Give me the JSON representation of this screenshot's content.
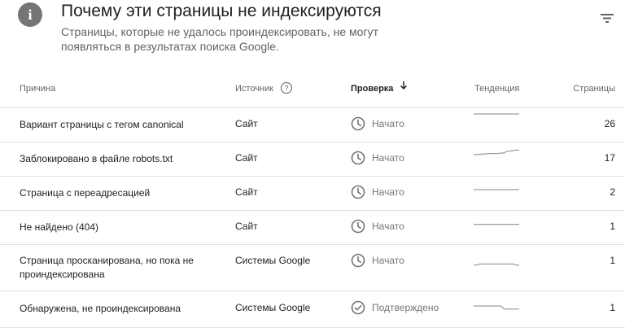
{
  "header": {
    "icon": "info-icon",
    "icon_glyph": "i",
    "title": "Почему эти страницы не индексируются",
    "subtitle": "Страницы, которые не удалось проиндексировать, не могут появляться в результатах поиска Google."
  },
  "table": {
    "columns": {
      "reason": "Причина",
      "source": "Источник",
      "check": "Проверка",
      "trend": "Тенденция",
      "pages": "Страницы"
    },
    "rows": [
      {
        "reason": "Вариант страницы с тегом canonical",
        "source": "Сайт",
        "status": "Начато",
        "status_icon": "clock-icon",
        "pages": "26",
        "trend": [
          1,
          1,
          1,
          1,
          1,
          1,
          1,
          1,
          1,
          1,
          1,
          1,
          1,
          1,
          1,
          1
        ]
      },
      {
        "reason": "Заблокировано в файле robots.txt",
        "source": "Сайт",
        "status": "Начато",
        "status_icon": "clock-icon",
        "pages": "17",
        "trend": [
          0.35,
          0.35,
          0.35,
          0.4,
          0.4,
          0.45,
          0.45,
          0.45,
          0.45,
          0.5,
          0.5,
          0.7,
          0.7,
          0.75,
          0.8,
          0.8
        ]
      },
      {
        "reason": "Страница с переадресацией",
        "source": "Сайт",
        "status": "Начато",
        "status_icon": "clock-icon",
        "pages": "2",
        "trend": [
          0.25,
          0.25,
          0.25,
          0.25,
          0.25,
          0.25,
          0.25,
          0.25,
          0.25,
          0.25,
          0.25,
          0.25,
          0.25,
          0.25,
          0.25,
          0.25
        ]
      },
      {
        "reason": "Не найдено (404)",
        "source": "Сайт",
        "status": "Начато",
        "status_icon": "clock-icon",
        "pages": "1",
        "trend": [
          0.2,
          0.2,
          0.2,
          0.2,
          0.2,
          0.2,
          0.2,
          0.2,
          0.2,
          0.2,
          0.2,
          0.2,
          0.2,
          0.2,
          0.2,
          0.2
        ]
      },
      {
        "reason": "Страница просканирована, но пока не проиндексирована",
        "source": "Системы Google",
        "status": "Начато",
        "status_icon": "clock-icon",
        "pages": "1",
        "trend": [
          0.2,
          0.2,
          0.3,
          0.3,
          0.3,
          0.3,
          0.3,
          0.3,
          0.3,
          0.3,
          0.3,
          0.3,
          0.3,
          0.3,
          0.2,
          0.2
        ]
      },
      {
        "reason": "Обнаружена, не проиндексирована",
        "source": "Системы Google",
        "status": "Подтверждено",
        "status_icon": "check-circle-icon",
        "pages": "1",
        "trend": [
          0.5,
          0.5,
          0.5,
          0.5,
          0.5,
          0.5,
          0.5,
          0.5,
          0.5,
          0.5,
          0.2,
          0.2,
          0.2,
          0.2,
          0.2,
          0.2
        ]
      }
    ]
  },
  "colors": {
    "trend_line": "#9e9e9e",
    "status_icon": "#757575",
    "divider": "#e0e0e0"
  }
}
